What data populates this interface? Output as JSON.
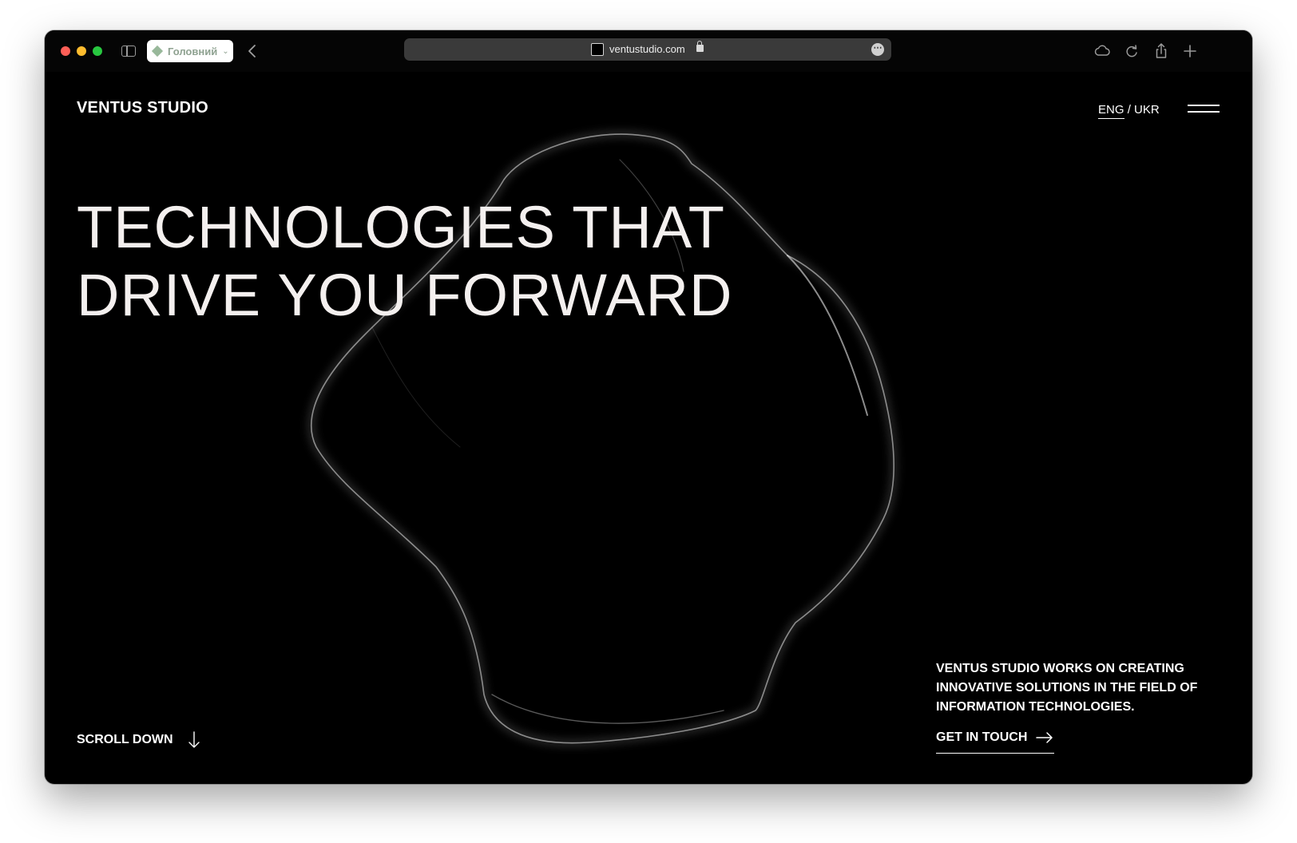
{
  "browser": {
    "tab_group_label": "Головний",
    "url": "ventustudio.com"
  },
  "header": {
    "logo": "VENTUS STUDIO",
    "lang_eng": "ENG",
    "lang_separator": "/",
    "lang_ukr": "UKR"
  },
  "hero": {
    "headline_line1": "TECHNOLOGIES THAT",
    "headline_line2": "DRIVE YOU FORWARD",
    "description": "VENTUS STUDIO WORKS ON CREATING INNOVATIVE SOLUTIONS IN THE FIELD OF INFORMATION TECHNOLOGIES.",
    "scroll_label": "SCROLL DOWN",
    "cta_label": "GET IN TOUCH"
  },
  "icons": {
    "tab": "diamond-icon",
    "back": "chevron-left-icon",
    "lock": "lock-icon",
    "more": "ellipsis-icon",
    "cloud": "cloud-icon",
    "reload": "reload-icon",
    "share": "share-icon",
    "new_tab": "plus-icon",
    "menu": "hamburger-icon",
    "scroll": "arrow-down-icon",
    "cta": "arrow-right-icon"
  },
  "colors": {
    "page_background": "#000000",
    "headline": "#f4f0ef",
    "text": "#ffffff",
    "address_bar": "#3a3a3a",
    "tab_accent": "#98b89a"
  }
}
